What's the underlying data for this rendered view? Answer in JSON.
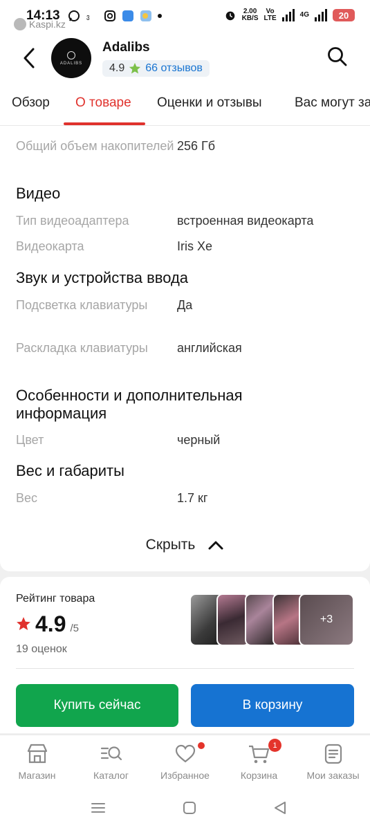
{
  "status_bar": {
    "time": "14:13",
    "speed_value": "2.00",
    "speed_unit": "KB/S",
    "network": "4G",
    "battery": "20",
    "app_label": "Kaspi.kz"
  },
  "header": {
    "store_name": "Adalibs",
    "avatar_text": "ADALIBS",
    "rating": "4.9",
    "reviews": "66 отзывов"
  },
  "tabs": [
    "Обзор",
    "О товаре",
    "Оценки и отзывы",
    "Вас могут за"
  ],
  "specs": {
    "storage_label": "Общий объем накопителей",
    "storage_value": "256 Гб",
    "video_title": "Видео",
    "adapter_type_label": "Тип видеоадаптера",
    "adapter_type_value": "встроенная видеокарта",
    "gpu_label": "Видеокарта",
    "gpu_value": "Iris Xe",
    "sound_title": "Звук и устройства ввода",
    "backlight_label": "Подсветка клавиатуры",
    "backlight_value": "Да",
    "layout_label": "Раскладка клавиатуры",
    "layout_value": "английская",
    "extra_title": "Особенности и дополнительная информация",
    "color_label": "Цвет",
    "color_value": "черный",
    "weight_title": "Вес и габариты",
    "weight_label": "Вес",
    "weight_value": "1.7 кг",
    "hide_label": "Скрыть"
  },
  "rating_card": {
    "title": "Рейтинг товара",
    "score": "4.9",
    "max": "/5",
    "count": "19 оценок",
    "more_photos": "+3"
  },
  "actions": {
    "buy_now": "Купить сейчас",
    "add_to_cart": "В корзину"
  },
  "bottom_nav": {
    "shop": "Магазин",
    "catalog": "Каталог",
    "favorites": "Избранное",
    "cart": "Корзина",
    "cart_badge": "1",
    "orders": "Мои заказы"
  },
  "colors": {
    "accent_red": "#e0322d",
    "buy_green": "#11a54d",
    "cart_blue": "#1673d2",
    "link_blue": "#1874d1"
  }
}
